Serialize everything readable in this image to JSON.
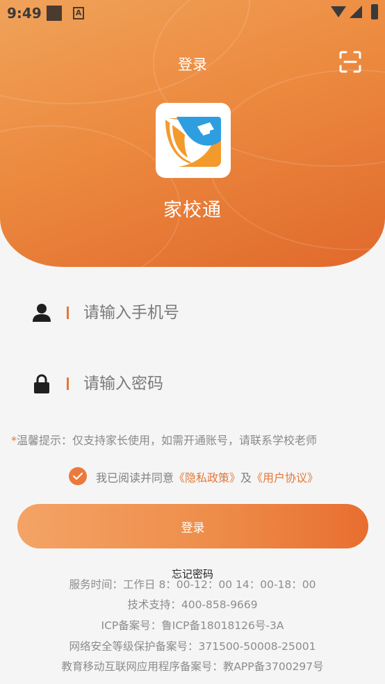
{
  "status_bar": {
    "time": "9:49",
    "notif_icon_letter": "A"
  },
  "header": {
    "title": "登录",
    "app_name": "家校通"
  },
  "form": {
    "phone": {
      "placeholder": "请输入手机号",
      "value": ""
    },
    "password": {
      "placeholder": "请输入密码",
      "value": ""
    }
  },
  "tip": {
    "star": "*",
    "text": "温馨提示：仅支持家长使用，如需开通账号，请联系学校老师"
  },
  "agreement": {
    "checked": true,
    "prefix": "我已阅读并同意",
    "privacy": "《隐私政策》",
    "and": "及",
    "terms": "《用户协议》"
  },
  "login_button": "登录",
  "forgot_password": "忘记密码",
  "footer": [
    "服务时间：工作日 8：00-12：00 14：00-18：00",
    "技术支持：400-858-9669",
    "ICP备案号：鲁ICP备18018126号-3A",
    "网络安全等级保护备案号：371500-50008-25001",
    "教育移动互联网应用程序备案号：教APP备3700297号"
  ],
  "colors": {
    "accent": "#e4773a",
    "header_start": "#f0a25a",
    "header_end": "#e0692c",
    "logo_blue": "#2f9ee0"
  },
  "icons": [
    "scan-icon",
    "user-icon",
    "lock-icon",
    "check-icon",
    "app-logo"
  ]
}
